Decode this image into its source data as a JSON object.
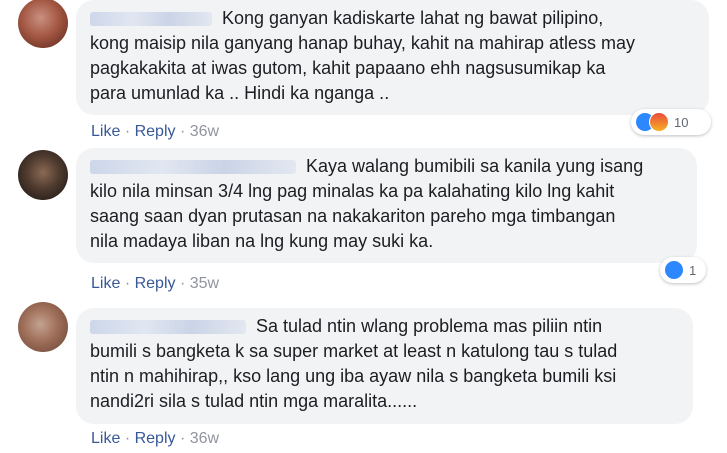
{
  "comments": [
    {
      "text_lines": [
        "Kong ganyan kadiskarte lahat ng bawat pilipino,",
        "kong maisip nila ganyang hanap buhay, kahit na mahirap atless may",
        "pagkakakita at iwas gutom, kahit papaano ehh nagsusumikap ka",
        "para umunlad ka .. Hindi ka nganga .."
      ],
      "like_label": "Like",
      "reply_label": "Reply",
      "time": "36w",
      "reaction_count": "10",
      "reaction_icons": [
        "like-icon",
        "angry-icon"
      ]
    },
    {
      "text_lines": [
        "Kaya walang bumibili sa kanila yung isang",
        "kilo nila minsan 3/4 lng pag minalas ka pa kalahating kilo lng kahit",
        "saang saan dyan prutasan na nakakariton pareho mga timbangan",
        "nila madaya liban na lng kung may suki ka."
      ],
      "like_label": "Like",
      "reply_label": "Reply",
      "time": "35w",
      "reaction_count": "1",
      "reaction_icons": [
        "like-icon"
      ]
    },
    {
      "text_lines": [
        "Sa tulad ntin wlang problema mas piliin ntin",
        "bumili s bangketa k sa super market at least n katulong tau s tulad",
        "ntin n mahihirap,, kso lang ung iba ayaw nila s bangketa bumili ksi",
        "nandi2ri sila s tulad ntin mga maralita......"
      ],
      "like_label": "Like",
      "reply_label": "Reply",
      "time": "36w"
    }
  ],
  "separator": "·",
  "colors": {
    "link": "#385898",
    "bubble": "#f2f3f5",
    "meta": "#90949c",
    "like_blue": "#2d88ff"
  }
}
